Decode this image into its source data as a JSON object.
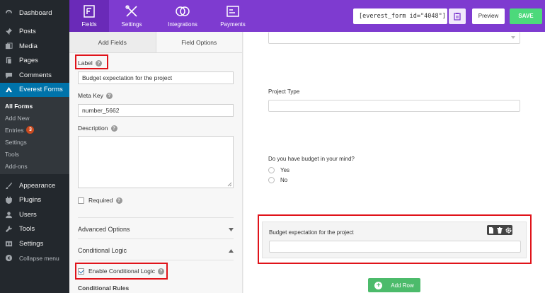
{
  "sidebar": {
    "items": [
      {
        "label": "Dashboard",
        "icon": "dashboard-icon"
      },
      {
        "label": "Posts",
        "icon": "pin-icon"
      },
      {
        "label": "Media",
        "icon": "media-icon"
      },
      {
        "label": "Pages",
        "icon": "pages-icon"
      },
      {
        "label": "Comments",
        "icon": "comment-icon"
      },
      {
        "label": "Everest Forms",
        "icon": "form-icon"
      }
    ],
    "submenu": [
      {
        "label": "All Forms"
      },
      {
        "label": "Add New"
      },
      {
        "label": "Entries",
        "badge": "3"
      },
      {
        "label": "Settings"
      },
      {
        "label": "Tools"
      },
      {
        "label": "Add-ons"
      }
    ],
    "items2": [
      {
        "label": "Appearance",
        "icon": "brush-icon"
      },
      {
        "label": "Plugins",
        "icon": "plugin-icon"
      },
      {
        "label": "Users",
        "icon": "user-icon"
      },
      {
        "label": "Tools",
        "icon": "wrench-icon"
      },
      {
        "label": "Settings",
        "icon": "settings-icon"
      },
      {
        "label": "Collapse menu",
        "icon": "collapse-icon"
      }
    ]
  },
  "topbar": {
    "tabs": [
      {
        "label": "Fields",
        "icon": "fields-icon"
      },
      {
        "label": "Settings",
        "icon": "tools-icon"
      },
      {
        "label": "Integrations",
        "icon": "rings-icon"
      },
      {
        "label": "Payments",
        "icon": "payments-icon"
      }
    ],
    "shortcode": "[everest_form id=\"4048\"]",
    "preview_label": "Preview",
    "save_label": "SAVE"
  },
  "panel": {
    "tabs": [
      "Add Fields",
      "Field Options"
    ],
    "label_caption": "Label",
    "label_value": "Budget expectation for the project",
    "meta_key_caption": "Meta Key",
    "meta_key_value": "number_5662",
    "description_caption": "Description",
    "required_caption": "Required",
    "advanced_options": "Advanced Options",
    "conditional_logic": "Conditional Logic",
    "enable_conditional": "Enable Conditional Logic",
    "conditional_rules": "Conditional Rules"
  },
  "canvas": {
    "project_type_label": "Project Type",
    "budget_question": "Do you have budget in your mind?",
    "radio_options": [
      "Yes",
      "No"
    ],
    "budget_field_label": "Budget expectation for the project",
    "add_row_label": "Add Row"
  },
  "colors": {
    "accent": "#7e3bd0",
    "save": "#4cd97b",
    "wp_active": "#0073aa",
    "highlight": "#e0131a"
  }
}
